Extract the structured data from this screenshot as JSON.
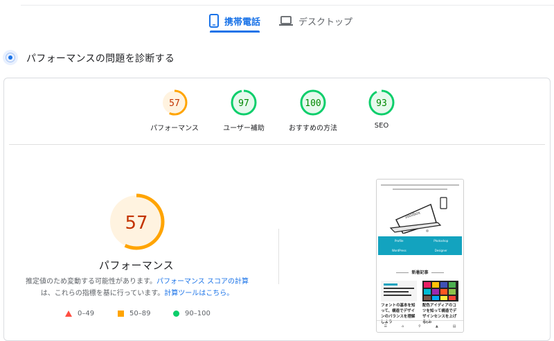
{
  "tabs": [
    {
      "label": "携帯電話",
      "icon": "smartphone-icon",
      "active": true
    },
    {
      "label": "デスクトップ",
      "icon": "laptop-icon",
      "active": false
    }
  ],
  "section": {
    "title": "パフォーマンスの問題を診断する"
  },
  "gauges": [
    {
      "score": "57",
      "label": "パフォーマンス",
      "value": 0.57,
      "status": "average"
    },
    {
      "score": "97",
      "label": "ユーザー補助",
      "value": 0.97,
      "status": "pass"
    },
    {
      "score": "100",
      "label": "おすすめの方法",
      "value": 1.0,
      "status": "pass"
    },
    {
      "score": "93",
      "label": "SEO",
      "value": 0.93,
      "status": "pass"
    }
  ],
  "main_gauge": {
    "score": "57",
    "label": "パフォーマンス",
    "value": 0.57
  },
  "note": {
    "text1": "推定値のため変動する可能性があります。",
    "link1": "パフォーマンス スコアの計算",
    "text2": "は、これらの指標を基に行っています。",
    "link2": "計算ツールはこちら。"
  },
  "legend": [
    {
      "range": "0–49",
      "shape": "triangle",
      "color": "#ff4e42"
    },
    {
      "range": "50–89",
      "shape": "square",
      "color": "#ffa400"
    },
    {
      "range": "90–100",
      "shape": "circle",
      "color": "#0cce6b"
    }
  ],
  "colors": {
    "accent": "#1a73e8",
    "average": "#ffa400",
    "average_text": "#c33300",
    "average_fill": "#fff3e0",
    "pass": "#0cce6b",
    "pass_text": "#008800",
    "pass_fill": "#e6f9ed"
  },
  "phone": {
    "grid": [
      "Profile",
      "Photoshop",
      "WordPress",
      "Designer"
    ],
    "new_posts": "新着記事",
    "post1": "フォントの基本を知って、構造でデザインのバランスを理解しよう",
    "post2": "配色アイディアのコツを知って構造でデザインセンスを上げる(お"
  }
}
